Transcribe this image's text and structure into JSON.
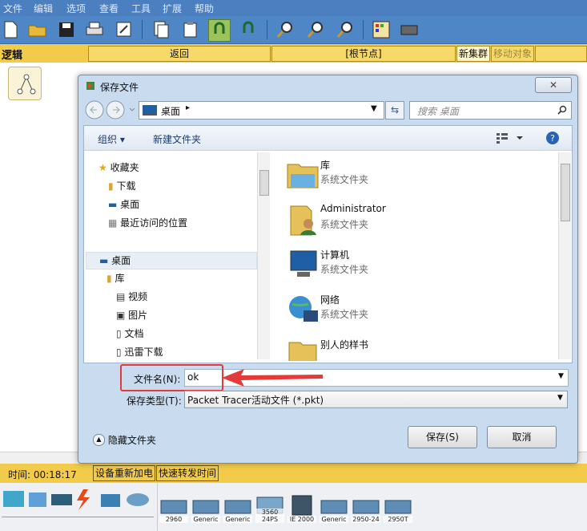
{
  "menu": [
    "文件",
    "编辑",
    "选项",
    "查看",
    "工具",
    "扩展",
    "帮助"
  ],
  "strip": {
    "logic": "逻辑",
    "back": "返回",
    "root": "[根节点]",
    "new_cluster": "新集群",
    "move_object": "移动对象"
  },
  "dialog": {
    "title": "保存文件",
    "address": "桌面",
    "search_placeholder": "搜索 桌面",
    "organize": "组织 ▾",
    "new_folder": "新建文件夹",
    "nav": {
      "favorites": "收藏夹",
      "downloads": "下载",
      "desktop_fav": "桌面",
      "recent": "最近访问的位置",
      "desktop": "桌面",
      "library": "库",
      "videos": "视频",
      "pictures": "图片",
      "docs": "文档",
      "xunlei": "迅雷下载"
    },
    "files": [
      {
        "name": "库",
        "type": "系统文件夹"
      },
      {
        "name": "Administrator",
        "type": "系统文件夹"
      },
      {
        "name": "计算机",
        "type": "系统文件夹"
      },
      {
        "name": "网络",
        "type": "系统文件夹"
      },
      {
        "name": "别人的样书",
        "type": ""
      }
    ],
    "filename_label": "文件名(N):",
    "filename_value": "ok",
    "filetype_label": "保存类型(T):",
    "filetype_value": "Packet Tracer活动文件 (*.pkt)",
    "hide_folders": "隐藏文件夹",
    "save": "保存(S)",
    "cancel": "取消"
  },
  "status": {
    "time": "时间: 00:18:17",
    "power_cycle": "设备重新加电",
    "fast_forward": "快速转发时间"
  },
  "devices": [
    "2960",
    "Generic",
    "Generic",
    "3560 24PS",
    "IE 2000",
    "Generic",
    "2950-24",
    "2950T"
  ]
}
